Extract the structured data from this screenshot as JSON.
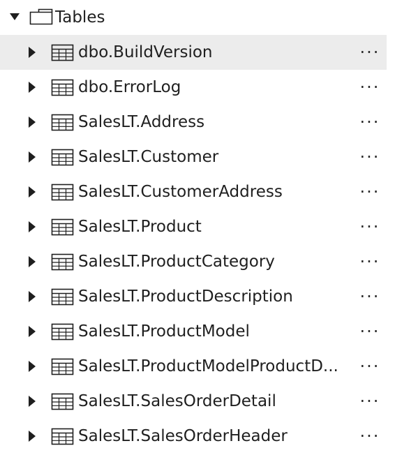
{
  "folder": {
    "label": "Tables",
    "expanded": true,
    "toggle_icon": "chevron-down-icon",
    "icon": "folder-icon"
  },
  "tables": [
    {
      "label": "dbo.BuildVersion",
      "selected": true
    },
    {
      "label": "dbo.ErrorLog",
      "selected": false
    },
    {
      "label": "SalesLT.Address",
      "selected": false
    },
    {
      "label": "SalesLT.Customer",
      "selected": false
    },
    {
      "label": "SalesLT.CustomerAddress",
      "selected": false
    },
    {
      "label": "SalesLT.Product",
      "selected": false
    },
    {
      "label": "SalesLT.ProductCategory",
      "selected": false
    },
    {
      "label": "SalesLT.ProductDescription",
      "selected": false
    },
    {
      "label": "SalesLT.ProductModel",
      "selected": false
    },
    {
      "label": "SalesLT.ProductModelProductD...",
      "selected": false
    },
    {
      "label": "SalesLT.SalesOrderDetail",
      "selected": false
    },
    {
      "label": "SalesLT.SalesOrderHeader",
      "selected": false
    }
  ],
  "row_icons": {
    "expand": "chevron-right-icon",
    "table": "table-icon",
    "more": "more-actions-icon"
  },
  "more_label": "···",
  "colors": {
    "selected_background": "#ececec",
    "text": "#1f1f1f",
    "icon": "#1f1f1f"
  }
}
